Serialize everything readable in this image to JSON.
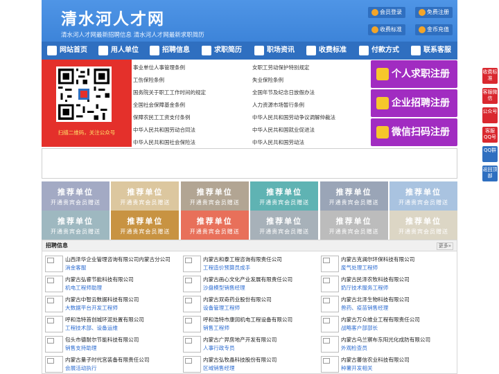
{
  "header": {
    "logo": "清水河人才网",
    "slogan": "清水河人才网最新招聘信息    清水河人才网最新求职简历",
    "buttons": [
      "会员登录",
      "免费注册",
      "收费标准",
      "金币充值"
    ]
  },
  "nav": [
    "网站首页",
    "用人单位",
    "招聘信息",
    "求职简历",
    "职场资讯",
    "收费标准",
    "付款方式",
    "联系客服"
  ],
  "qr": {
    "caption": "扫描二维码，关注公众号"
  },
  "laws": {
    "left": [
      "事业单位人事管理条例",
      "工伤保险条例",
      "国务院关于职工工作时间的规定",
      "全国社会保障基金条例",
      "保障农民工工资支付条例",
      "中华人民共和国劳动合同法",
      "中华人民共和国社会保险法"
    ],
    "right": [
      "女职工劳动保护特别规定",
      "失业保险条例",
      "全国年节及纪念日放假办法",
      "人力资源市场暂行条例",
      "中华人民共和国劳动争议调解仲裁法",
      "中华人民共和国就业促进法",
      "中华人民共和国劳动法"
    ]
  },
  "register": [
    "个人求职注册",
    "企业招聘注册",
    "微信扫码注册"
  ],
  "promo": {
    "title": "推荐单位",
    "subtitle": "开通贵宾会员赠送",
    "colors": [
      "#a3aac4",
      "#dcc79f",
      "#b2a593",
      "#5fb3b3",
      "#9aa5b7",
      "#a9c3e0",
      "#9eb8c0",
      "#c89342",
      "#e8705a",
      "#a7b1b9",
      "#bcbcbc",
      "#dcd6c5"
    ]
  },
  "jobs": {
    "title": "招聘信息",
    "more": "更多»",
    "items": [
      {
        "company": "山西泽华企业管理咨询有限公司内蒙古分公司",
        "position": "消金客服"
      },
      {
        "company": "内蒙古和泰工程咨询有限责任公司",
        "position": "工程造价预算员成手"
      },
      {
        "company": "内蒙古克澜尔环保科技有限公司",
        "position": "废气处理工程师"
      },
      {
        "company": "内蒙古弘睿节能科技有限公司",
        "position": "机电工程师助理"
      },
      {
        "company": "内蒙古画心文化产业发展有限责任公司",
        "position": "沙盘模型销售经理"
      },
      {
        "company": "内蒙古民泽农牧科技有限公司",
        "position": "奶厅技术服务工程师"
      },
      {
        "company": "内蒙古中智云数据科技有限公司",
        "position": "大数据平台开发工程师"
      },
      {
        "company": "内蒙古双奇药业股份有限公司",
        "position": "设备管理工程师"
      },
      {
        "company": "内蒙古北泽生物科技有限公司",
        "position": "兽药、疫苗销售经理"
      },
      {
        "company": "呼和浩特首创城环泥处置有限公司",
        "position": "工程技术部、设备运维"
      },
      {
        "company": "呼和浩特市康润机电工程设备有限公司",
        "position": "销售工程师"
      },
      {
        "company": "内蒙古万众维业工程有限责任公司",
        "position": "战略客户部部长"
      },
      {
        "company": "包头市德耐尔节能科技有限公司",
        "position": "销售支持助理"
      },
      {
        "company": "内蒙古广羿房地产开发有限公司",
        "position": "人事行政专员"
      },
      {
        "company": "内蒙古乌兰察布东阳光化成防有限公司",
        "position": "外观检查员"
      },
      {
        "company": "内蒙古量子时代宫装备有限责任公司",
        "position": "会展活动执行"
      },
      {
        "company": "内蒙古弘牧晶科技股份有限公司",
        "position": "区域销售经理"
      },
      {
        "company": "内蒙古蕃信农业科技有限公司",
        "position": "种薯开发相关"
      }
    ]
  },
  "sidebar": [
    "收费标准",
    "客服微信",
    "公众号",
    "客服QQ号",
    "QQ群",
    "返回顶部"
  ]
}
